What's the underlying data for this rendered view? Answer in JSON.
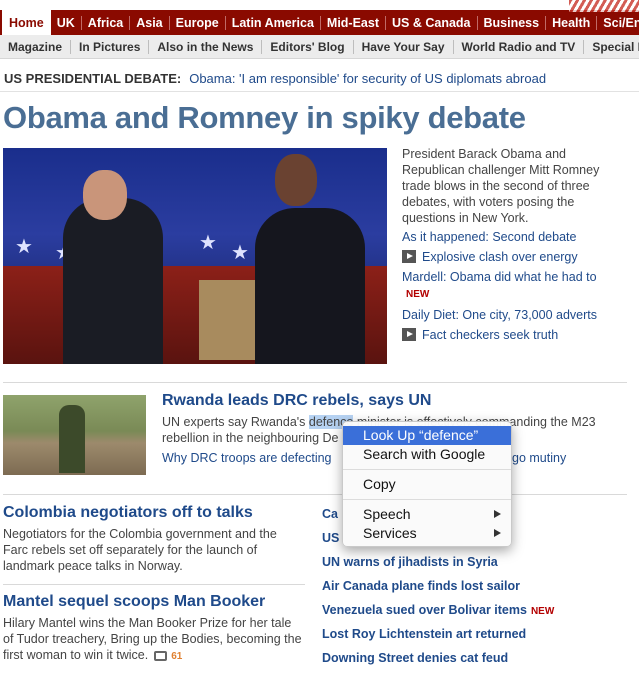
{
  "nav_primary": [
    "Home",
    "UK",
    "Africa",
    "Asia",
    "Europe",
    "Latin America",
    "Mid-East",
    "US & Canada",
    "Business",
    "Health",
    "Sci/Enviro"
  ],
  "nav_secondary": [
    "Magazine",
    "In Pictures",
    "Also in the News",
    "Editors' Blog",
    "Have Your Say",
    "World Radio and TV",
    "Special Re"
  ],
  "breaking": {
    "label": "US PRESIDENTIAL DEBATE:",
    "link": "Obama: 'I am responsible' for security of US diplomats abroad"
  },
  "lead": {
    "headline": "Obama and Romney in spiky debate",
    "summary": "President Barack Obama and Republican challenger Mitt Romney trade blows in the second of three debates, with voters posing the questions in New York.",
    "links": [
      {
        "text": "As it happened: Second debate",
        "video": false,
        "new": false
      },
      {
        "text": "Explosive clash over energy",
        "video": true,
        "new": false
      },
      {
        "text": "Mardell: Obama did what he had to",
        "video": false,
        "new": true
      },
      {
        "text": "Daily Diet: One city, 73,000 adverts",
        "video": false,
        "new": false
      },
      {
        "text": "Fact checkers seek truth",
        "video": true,
        "new": false
      }
    ],
    "new_label": "NEW"
  },
  "rwanda": {
    "headline": "Rwanda leads DRC rebels, says UN",
    "text_before": "UN experts say Rwanda's ",
    "text_selected": "defence",
    "text_after": " minister is effectively commanding the M23 rebellion in the neighbouring De",
    "link1": "Why DRC troops are defecting",
    "link2": "go mutiny"
  },
  "stories": [
    {
      "headline": "Colombia negotiators off to talks",
      "text": "Negotiators for the Colombia government and the Farc rebels set off separately for the launch of landmark peace talks in Norway."
    },
    {
      "headline": "Mantel sequel scoops Man Booker",
      "text": "Hilary Mantel wins the Man Booker Prize for her tale of Tudor treachery, Bring up the Bodies, becoming the first woman to win it twice.",
      "comments": "61"
    }
  ],
  "right_list": [
    {
      "text": "Ca",
      "new": false
    },
    {
      "text": "US",
      "new": false
    },
    {
      "text": "UN warns of jihadists in Syria",
      "new": false
    },
    {
      "text": "Air Canada plane finds lost sailor",
      "new": false
    },
    {
      "text": "Venezuela sued over Bolivar items",
      "new": true
    },
    {
      "text": "Lost Roy Lichtenstein art returned",
      "new": false
    },
    {
      "text": "Downing Street denies cat feud",
      "new": false
    }
  ],
  "context_menu": {
    "items": [
      "Look Up “defence”",
      "Search with Google",
      "Copy",
      "Speech",
      "Services"
    ]
  }
}
